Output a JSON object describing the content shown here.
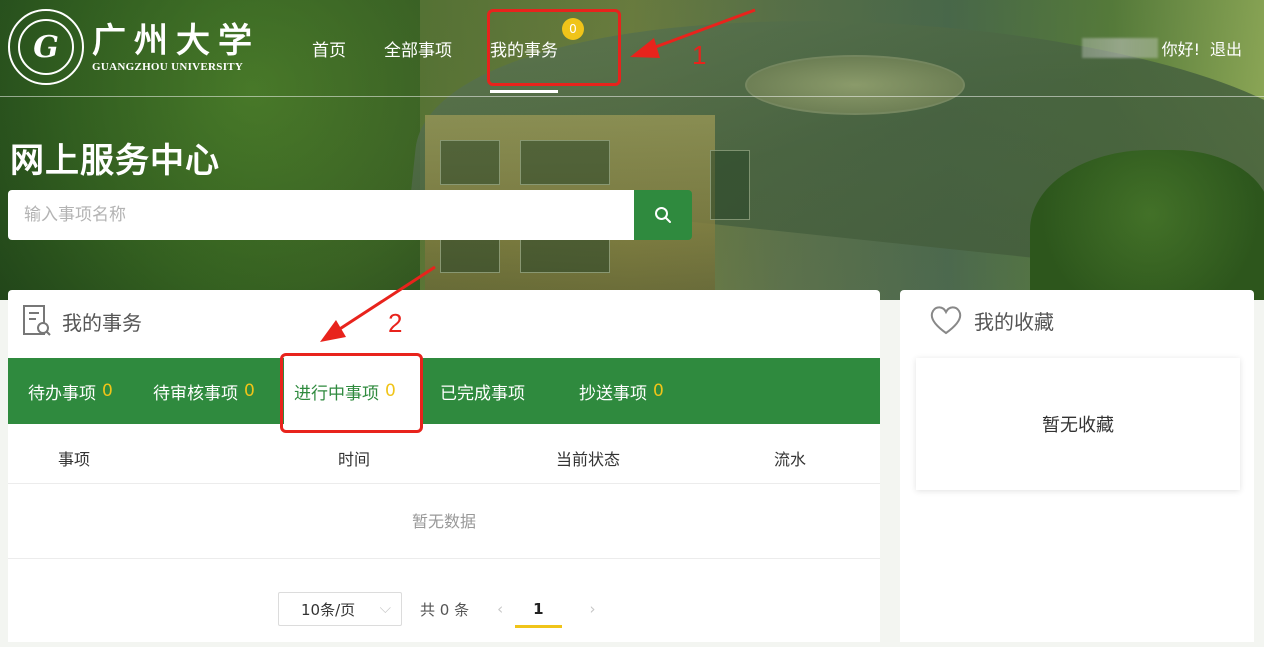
{
  "header": {
    "logo_cn": "广州大学",
    "logo_en": "GUANGZHOU UNIVERSITY",
    "nav": [
      {
        "label": "首页"
      },
      {
        "label": "全部事项"
      },
      {
        "label": "我的事务",
        "badge": "0"
      }
    ],
    "greeting": "你好!",
    "logout": "退出"
  },
  "hero": {
    "title": "网上服务中心",
    "search_placeholder": "输入事项名称"
  },
  "annotations": {
    "step1": "1",
    "step2": "2"
  },
  "main": {
    "title": "我的事务",
    "tabs": [
      {
        "label": "待办事项",
        "count": "0"
      },
      {
        "label": "待审核事项",
        "count": "0"
      },
      {
        "label": "进行中事项",
        "count": "0"
      },
      {
        "label": "已完成事项",
        "count": ""
      },
      {
        "label": "抄送事项",
        "count": "0"
      }
    ],
    "columns": [
      "事项",
      "时间",
      "当前状态",
      "流水"
    ],
    "empty_text": "暂无数据",
    "pagination": {
      "page_size": "10条/页",
      "total": "共 0 条",
      "current_page": "1"
    }
  },
  "side": {
    "title": "我的收藏",
    "empty_text": "暂无收藏"
  },
  "colors": {
    "primary_green": "#2f8a3e",
    "badge_yellow": "#f0c419",
    "annotation_red": "#e8231c"
  }
}
